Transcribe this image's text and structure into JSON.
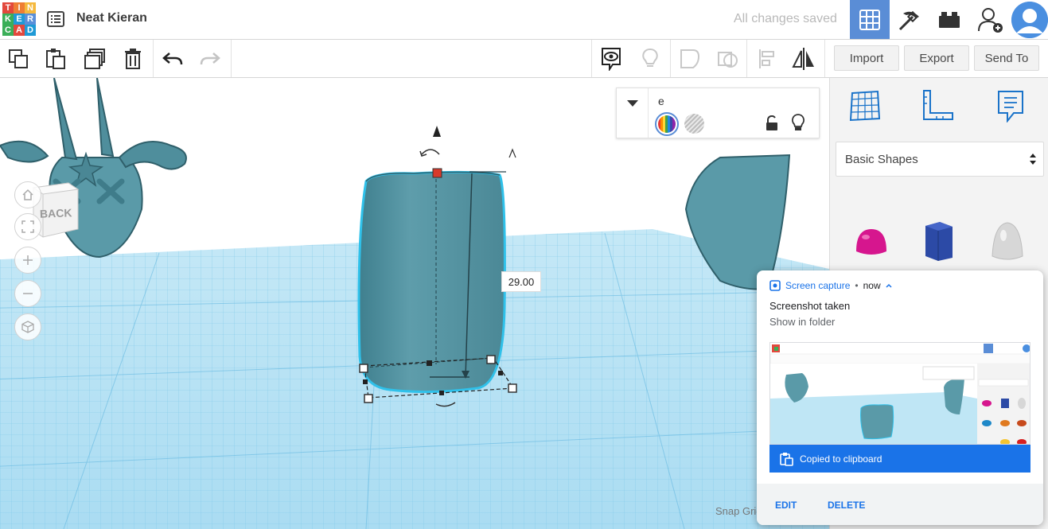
{
  "header": {
    "logo_letters": [
      "T",
      "I",
      "N",
      "K",
      "E",
      "R",
      "C",
      "A",
      "D"
    ],
    "logo_colors": [
      "#e2483d",
      "#ee7e35",
      "#f5b93e",
      "#3bae58",
      "#1f9ad6",
      "#5a8fd9",
      "#3bae58",
      "#e2483d",
      "#1f9ad6"
    ],
    "project_name": "Neat Kieran",
    "save_status": "All changes saved"
  },
  "toolbar": {
    "import_label": "Import",
    "export_label": "Export",
    "send_to_label": "Send To"
  },
  "workplane": {
    "viewcube_label": "BACK",
    "dimension_value": "29.00",
    "snap_grid_label": "Snap Grid"
  },
  "inspector": {
    "shape_name": "e"
  },
  "right_panel": {
    "category_selected": "Basic Shapes"
  },
  "notification": {
    "app_name": "Screen capture",
    "time": "now",
    "title": "Screenshot taken",
    "body": "Show in folder",
    "clipboard_text": "Copied to clipboard",
    "edit_label": "EDIT",
    "delete_label": "DELETE"
  },
  "colors": {
    "accent": "#5a8dd6",
    "shape_teal": "#5a9aa8",
    "selection_outline": "#2fc1ea",
    "notification_blue": "#1a73e8"
  }
}
